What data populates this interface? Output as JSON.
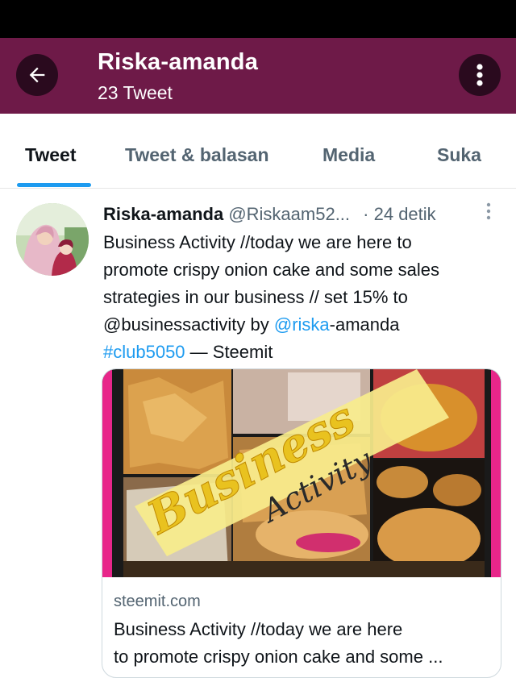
{
  "header": {
    "title": "Riska-amanda",
    "subtitle": "23 Tweet"
  },
  "tabs": [
    {
      "label": "Tweet",
      "active": true
    },
    {
      "label": "Tweet & balasan",
      "active": false
    },
    {
      "label": "Media",
      "active": false
    },
    {
      "label": "Suka",
      "active": false
    }
  ],
  "tweet": {
    "name": "Riska-amanda",
    "handle": "@Riskaam52...",
    "separator": "·",
    "time": "24 detik",
    "lines": {
      "l1": "Business Activity //today we are here to",
      "l2": "promote crispy onion cake and some sales",
      "l3": "strategies in our business // set 15% to",
      "l4_text": "@businessactivity by ",
      "l4_link": "@riska",
      "l4_rest": "-amanda",
      "l5_link": "#club5050",
      "l5_rest": " — Steemit"
    },
    "card": {
      "domain": "steemit.com",
      "desc_line1": "Business Activity //today we are here",
      "desc_line2": "to promote crispy onion cake and some ...",
      "image_text_1": "Business",
      "image_text_2": "Activity"
    }
  },
  "colors": {
    "header_bg": "#6e1a48",
    "accent": "#1d9bf0",
    "card_border_pink": "#e8268a"
  }
}
